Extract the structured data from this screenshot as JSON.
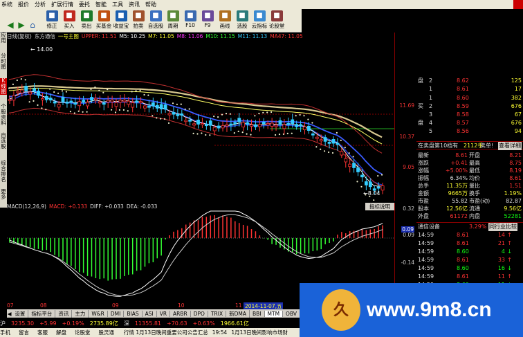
{
  "menu": {
    "items": [
      "系统",
      "报价",
      "分析",
      "扩展行情",
      "委托",
      "智能",
      "工具",
      "资讯",
      "帮助"
    ]
  },
  "toolbar": {
    "buttons": [
      {
        "label": "修正",
        "icon": "edit-icon",
        "color": "#2a5fa8"
      },
      {
        "label": "买入",
        "icon": "buy-icon",
        "color": "#c0281e"
      },
      {
        "label": "卖出",
        "icon": "sell-icon",
        "color": "#1e7a2a"
      },
      {
        "label": "买基金",
        "icon": "fund-icon",
        "color": "#c05010"
      },
      {
        "label": "收益宝",
        "icon": "wallet-icon",
        "color": "#1a5fb0"
      },
      {
        "label": "拍卖",
        "icon": "auction-icon",
        "color": "#a0522d"
      },
      {
        "label": "自选股",
        "icon": "favorites-icon",
        "color": "#3b70c0"
      },
      {
        "label": "周期",
        "icon": "period-icon",
        "color": "#5a8a3a"
      },
      {
        "label": "F10",
        "icon": "info-icon",
        "color": "#3a6ab0"
      },
      {
        "label": "F9",
        "icon": "chart-icon",
        "color": "#6a4a9a"
      },
      {
        "label": "画线",
        "icon": "pen-icon",
        "color": "#b07020"
      },
      {
        "label": "选股",
        "icon": "filter-icon",
        "color": "#2a7a7a"
      },
      {
        "label": "云指标",
        "icon": "cloud-icon",
        "color": "#3a8ad0"
      },
      {
        "label": "论股堂",
        "icon": "forum-icon",
        "color": "#8a3a3a"
      }
    ]
  },
  "left_tabs": [
    "应用",
    "分时图",
    "K线图",
    "个股资料",
    "自选股",
    "综合排名",
    "更多"
  ],
  "chart_header": {
    "period": "日线(复权)",
    "name": "东方通信",
    "indicator": "一号主图",
    "upper_label": "UPPER: 11.51",
    "ma_items": [
      {
        "text": "M5: 10.25",
        "color": "#ffffff"
      },
      {
        "text": "M7: 11.05",
        "color": "#ffff33"
      },
      {
        "text": "M8: 11.06",
        "color": "#ff33ff"
      },
      {
        "text": "M10: 11.15",
        "color": "#33ff33"
      },
      {
        "text": "M11: 11.13",
        "color": "#33ccff"
      },
      {
        "text": "MA47: 11.05",
        "color": "#ff3333"
      }
    ]
  },
  "price_axis": [
    "11.69",
    "10.37",
    "9.05"
  ],
  "price_annotations": {
    "high": "14.00",
    "low": "8.04"
  },
  "macd_header": {
    "label": "MACD(12,26,9)",
    "macd": "MACD: +0.133",
    "diff": "DIFF: +0.033",
    "dea": "DEA: -0.033",
    "indicator_help": "指标说明"
  },
  "macd_axis": [
    "0.32",
    "0.09",
    "-0.14",
    "-0.37"
  ],
  "macd_current": "0.09",
  "date_axis": {
    "labels": [
      "07",
      "08",
      "09",
      "10",
      "11"
    ],
    "highlight": "2014-11-07,五"
  },
  "quote": {
    "sell_label": "卖",
    "buy_label": "买",
    "disk_label": "盘",
    "sell_rows": [
      {
        "level": "2",
        "price": "8.62",
        "vol": "125"
      },
      {
        "level": "1",
        "price": "8.61",
        "vol": "17"
      }
    ],
    "buy_rows": [
      {
        "level": "1",
        "price": "8.60",
        "vol": "382"
      },
      {
        "level": "2",
        "price": "8.59",
        "vol": "676"
      },
      {
        "level": "3",
        "price": "8.58",
        "vol": "67"
      },
      {
        "level": "4",
        "price": "8.57",
        "vol": "676"
      },
      {
        "level": "5",
        "price": "8.56",
        "vol": "94"
      }
    ],
    "level_banner": {
      "left": "在卖盘第10档有",
      "mid": "2112手",
      "right": "卖单!",
      "link": "查看详细"
    },
    "stats": [
      {
        "l1": "最新",
        "v1": "8.61",
        "l2": "开盘",
        "v2": "8.21",
        "c1": "red",
        "c2": "red"
      },
      {
        "l1": "涨跌",
        "v1": "+0.41",
        "l2": "最高",
        "v2": "8.75",
        "c1": "red",
        "c2": "red"
      },
      {
        "l1": "涨幅",
        "v1": "+5.00%",
        "l2": "最低",
        "v2": "8.19",
        "c1": "red",
        "c2": "red"
      },
      {
        "l1": "振幅",
        "v1": "6.34%",
        "l2": "均价",
        "v2": "8.61",
        "c1": "white",
        "c2": "red"
      },
      {
        "l1": "总手",
        "v1": "11.35万",
        "l2": "量比",
        "v2": "1.51",
        "c1": "yellow",
        "c2": "red"
      },
      {
        "l1": "金额",
        "v1": "9665万",
        "l2": "换手",
        "v2": "1.19%",
        "c1": "yellow",
        "c2": "yellow"
      },
      {
        "l1": "市盈",
        "v1": "55.82",
        "l2": "市盈(动)",
        "v2": "82.87",
        "c1": "white",
        "c2": "white"
      },
      {
        "l1": "股本",
        "v1": "12.56亿",
        "l2": "流通",
        "v2": "9.56亿",
        "c1": "yellow",
        "c2": "yellow"
      },
      {
        "l1": "外盘",
        "v1": "61172",
        "l2": "内盘",
        "v2": "52281",
        "c1": "red",
        "c2": "green"
      }
    ],
    "sector": {
      "name": "通信设备",
      "change": "3.29%",
      "link": "同行业比较"
    },
    "ticks": [
      {
        "time": "14:59",
        "price": "8.61",
        "vol": "14",
        "dir": "up"
      },
      {
        "time": "14:59",
        "price": "8.61",
        "vol": "21",
        "dir": "up"
      },
      {
        "time": "14:59",
        "price": "8.60",
        "vol": "4",
        "dir": "down"
      },
      {
        "time": "14:59",
        "price": "8.61",
        "vol": "33",
        "dir": "up"
      },
      {
        "time": "14:59",
        "price": "8.60",
        "vol": "16",
        "dir": "down"
      },
      {
        "time": "14:59",
        "price": "8.61",
        "vol": "11",
        "dir": "up"
      },
      {
        "time": "14:59",
        "price": "8.60",
        "vol": "11",
        "dir": "down"
      },
      {
        "time": "14:59",
        "price": "8.60",
        "vol": "12",
        "dir": "down"
      }
    ]
  },
  "bottom_tabs": [
    "设置",
    "指标平台",
    "资讯",
    "主力",
    "W&R",
    "DMI",
    "BIAS",
    "ASI",
    "VR",
    "ARBR",
    "DPO",
    "TRIX",
    "新DMA",
    "BBI",
    "MTM",
    "OBV"
  ],
  "status1": {
    "prefix": "沪",
    "index1": "3235.30",
    "chg1": "+5.99",
    "pct1": "+0.19%",
    "amt1": "2735.89亿",
    "name2": "深",
    "index2": "11355.81",
    "chg2": "+70.63",
    "pct2": "+0.63%",
    "amt2": "1966.61亿"
  },
  "status2": {
    "items": [
      "手机",
      "留言",
      "客服",
      "解盘",
      "论股堂",
      "股灵通"
    ],
    "ticker": "行情 1月13日晚间重要公司公告汇总",
    "time": "19:54",
    "ticker2": "1月13日晚间影响市场财"
  },
  "watermark": {
    "logo_text": "久",
    "url": "www.9m8.cn"
  },
  "colors": {
    "up": "#ff3333",
    "down": "#33ff33",
    "ma5": "#ffffff",
    "bg": "#000000"
  }
}
